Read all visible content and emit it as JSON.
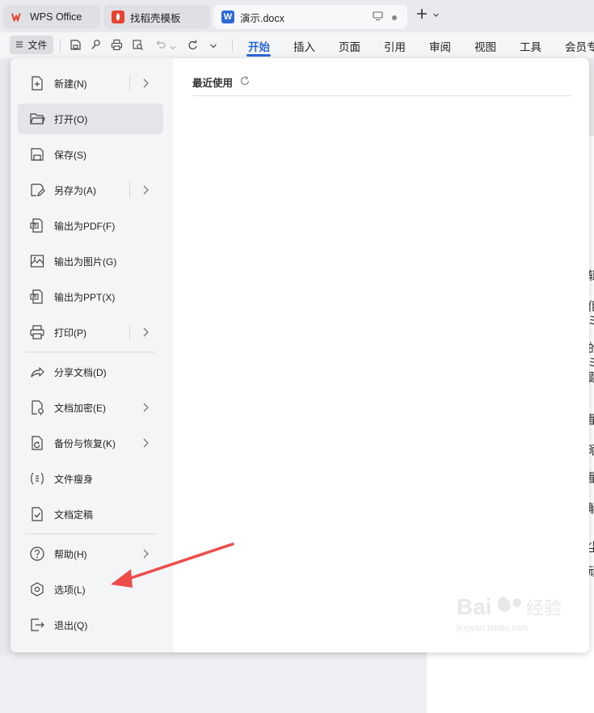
{
  "tabs": [
    {
      "label": "WPS Office",
      "icon": "wps-logo-icon"
    },
    {
      "label": "找稻壳模板",
      "icon": "docer-logo-icon"
    },
    {
      "label": "演示.docx",
      "icon": "word-doc-icon"
    }
  ],
  "toolbar": {
    "file_label": "文件",
    "ribbon_tabs": [
      "开始",
      "插入",
      "页面",
      "引用",
      "审阅",
      "视图",
      "工具",
      "会员专"
    ]
  },
  "menu": {
    "groups": [
      [
        {
          "label": "新建(N)",
          "icon": "new-doc-icon",
          "submenu": true
        },
        {
          "label": "打开(O)",
          "icon": "open-folder-icon",
          "submenu": false,
          "active": true
        },
        {
          "label": "保存(S)",
          "icon": "save-icon",
          "submenu": false
        },
        {
          "label": "另存为(A)",
          "icon": "save-as-icon",
          "submenu": true
        },
        {
          "label": "输出为PDF(F)",
          "icon": "export-pdf-icon",
          "submenu": false
        },
        {
          "label": "输出为图片(G)",
          "icon": "export-image-icon",
          "submenu": false
        },
        {
          "label": "输出为PPT(X)",
          "icon": "export-ppt-icon",
          "submenu": false
        },
        {
          "label": "打印(P)",
          "icon": "print-icon",
          "submenu": true
        }
      ],
      [
        {
          "label": "分享文档(D)",
          "icon": "share-icon",
          "submenu": false
        },
        {
          "label": "文档加密(E)",
          "icon": "encrypt-icon",
          "submenu": true
        },
        {
          "label": "备份与恢复(K)",
          "icon": "backup-icon",
          "submenu": true
        },
        {
          "label": "文件瘦身",
          "icon": "slim-file-icon",
          "submenu": false
        },
        {
          "label": "文档定稿",
          "icon": "finalize-icon",
          "submenu": false
        }
      ],
      [
        {
          "label": "帮助(H)",
          "icon": "help-icon",
          "submenu": true
        },
        {
          "label": "选项(L)",
          "icon": "options-hexagon-icon",
          "submenu": false
        },
        {
          "label": "退出(Q)",
          "icon": "exit-icon",
          "submenu": false
        }
      ]
    ],
    "recent_title": "最近使用"
  },
  "colors": {
    "accent": "#2b68d9",
    "annotation_arrow": "#ee4b4b",
    "wps_red": "#e8412f"
  },
  "watermark": {
    "text": "Bai",
    "sub": "jingyan.baidu.com"
  },
  "doc_edge_glyphs": [
    "辑",
    "佢",
    "ミ",
    "的",
    "ミ",
    "顕",
    "量",
    "〈",
    "晒",
    "量",
    "〈",
    "解",
    "〈",
    "尘",
    "顽",
    "〈"
  ]
}
